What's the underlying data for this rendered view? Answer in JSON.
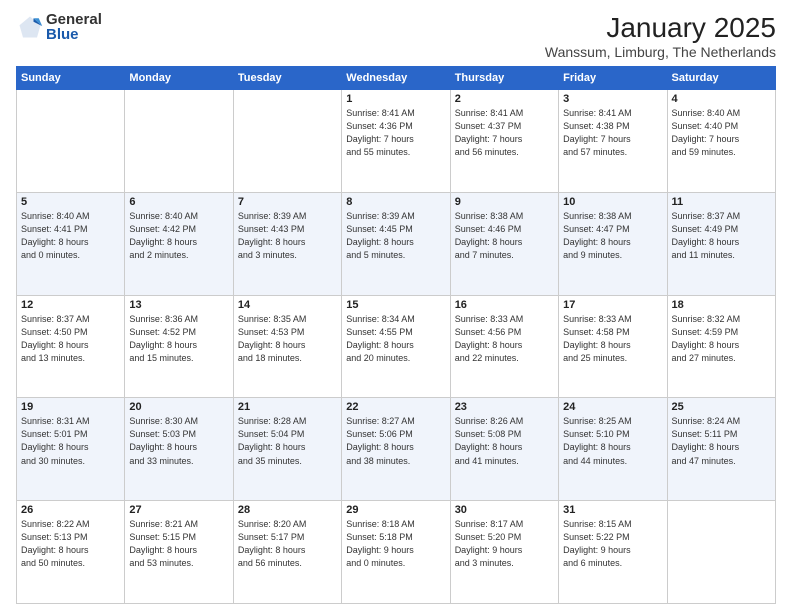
{
  "logo": {
    "general": "General",
    "blue": "Blue"
  },
  "title": "January 2025",
  "subtitle": "Wanssum, Limburg, The Netherlands",
  "headers": [
    "Sunday",
    "Monday",
    "Tuesday",
    "Wednesday",
    "Thursday",
    "Friday",
    "Saturday"
  ],
  "weeks": [
    [
      {
        "day": "",
        "detail": ""
      },
      {
        "day": "",
        "detail": ""
      },
      {
        "day": "",
        "detail": ""
      },
      {
        "day": "1",
        "detail": "Sunrise: 8:41 AM\nSunset: 4:36 PM\nDaylight: 7 hours\nand 55 minutes."
      },
      {
        "day": "2",
        "detail": "Sunrise: 8:41 AM\nSunset: 4:37 PM\nDaylight: 7 hours\nand 56 minutes."
      },
      {
        "day": "3",
        "detail": "Sunrise: 8:41 AM\nSunset: 4:38 PM\nDaylight: 7 hours\nand 57 minutes."
      },
      {
        "day": "4",
        "detail": "Sunrise: 8:40 AM\nSunset: 4:40 PM\nDaylight: 7 hours\nand 59 minutes."
      }
    ],
    [
      {
        "day": "5",
        "detail": "Sunrise: 8:40 AM\nSunset: 4:41 PM\nDaylight: 8 hours\nand 0 minutes."
      },
      {
        "day": "6",
        "detail": "Sunrise: 8:40 AM\nSunset: 4:42 PM\nDaylight: 8 hours\nand 2 minutes."
      },
      {
        "day": "7",
        "detail": "Sunrise: 8:39 AM\nSunset: 4:43 PM\nDaylight: 8 hours\nand 3 minutes."
      },
      {
        "day": "8",
        "detail": "Sunrise: 8:39 AM\nSunset: 4:45 PM\nDaylight: 8 hours\nand 5 minutes."
      },
      {
        "day": "9",
        "detail": "Sunrise: 8:38 AM\nSunset: 4:46 PM\nDaylight: 8 hours\nand 7 minutes."
      },
      {
        "day": "10",
        "detail": "Sunrise: 8:38 AM\nSunset: 4:47 PM\nDaylight: 8 hours\nand 9 minutes."
      },
      {
        "day": "11",
        "detail": "Sunrise: 8:37 AM\nSunset: 4:49 PM\nDaylight: 8 hours\nand 11 minutes."
      }
    ],
    [
      {
        "day": "12",
        "detail": "Sunrise: 8:37 AM\nSunset: 4:50 PM\nDaylight: 8 hours\nand 13 minutes."
      },
      {
        "day": "13",
        "detail": "Sunrise: 8:36 AM\nSunset: 4:52 PM\nDaylight: 8 hours\nand 15 minutes."
      },
      {
        "day": "14",
        "detail": "Sunrise: 8:35 AM\nSunset: 4:53 PM\nDaylight: 8 hours\nand 18 minutes."
      },
      {
        "day": "15",
        "detail": "Sunrise: 8:34 AM\nSunset: 4:55 PM\nDaylight: 8 hours\nand 20 minutes."
      },
      {
        "day": "16",
        "detail": "Sunrise: 8:33 AM\nSunset: 4:56 PM\nDaylight: 8 hours\nand 22 minutes."
      },
      {
        "day": "17",
        "detail": "Sunrise: 8:33 AM\nSunset: 4:58 PM\nDaylight: 8 hours\nand 25 minutes."
      },
      {
        "day": "18",
        "detail": "Sunrise: 8:32 AM\nSunset: 4:59 PM\nDaylight: 8 hours\nand 27 minutes."
      }
    ],
    [
      {
        "day": "19",
        "detail": "Sunrise: 8:31 AM\nSunset: 5:01 PM\nDaylight: 8 hours\nand 30 minutes."
      },
      {
        "day": "20",
        "detail": "Sunrise: 8:30 AM\nSunset: 5:03 PM\nDaylight: 8 hours\nand 33 minutes."
      },
      {
        "day": "21",
        "detail": "Sunrise: 8:28 AM\nSunset: 5:04 PM\nDaylight: 8 hours\nand 35 minutes."
      },
      {
        "day": "22",
        "detail": "Sunrise: 8:27 AM\nSunset: 5:06 PM\nDaylight: 8 hours\nand 38 minutes."
      },
      {
        "day": "23",
        "detail": "Sunrise: 8:26 AM\nSunset: 5:08 PM\nDaylight: 8 hours\nand 41 minutes."
      },
      {
        "day": "24",
        "detail": "Sunrise: 8:25 AM\nSunset: 5:10 PM\nDaylight: 8 hours\nand 44 minutes."
      },
      {
        "day": "25",
        "detail": "Sunrise: 8:24 AM\nSunset: 5:11 PM\nDaylight: 8 hours\nand 47 minutes."
      }
    ],
    [
      {
        "day": "26",
        "detail": "Sunrise: 8:22 AM\nSunset: 5:13 PM\nDaylight: 8 hours\nand 50 minutes."
      },
      {
        "day": "27",
        "detail": "Sunrise: 8:21 AM\nSunset: 5:15 PM\nDaylight: 8 hours\nand 53 minutes."
      },
      {
        "day": "28",
        "detail": "Sunrise: 8:20 AM\nSunset: 5:17 PM\nDaylight: 8 hours\nand 56 minutes."
      },
      {
        "day": "29",
        "detail": "Sunrise: 8:18 AM\nSunset: 5:18 PM\nDaylight: 9 hours\nand 0 minutes."
      },
      {
        "day": "30",
        "detail": "Sunrise: 8:17 AM\nSunset: 5:20 PM\nDaylight: 9 hours\nand 3 minutes."
      },
      {
        "day": "31",
        "detail": "Sunrise: 8:15 AM\nSunset: 5:22 PM\nDaylight: 9 hours\nand 6 minutes."
      },
      {
        "day": "",
        "detail": ""
      }
    ]
  ]
}
